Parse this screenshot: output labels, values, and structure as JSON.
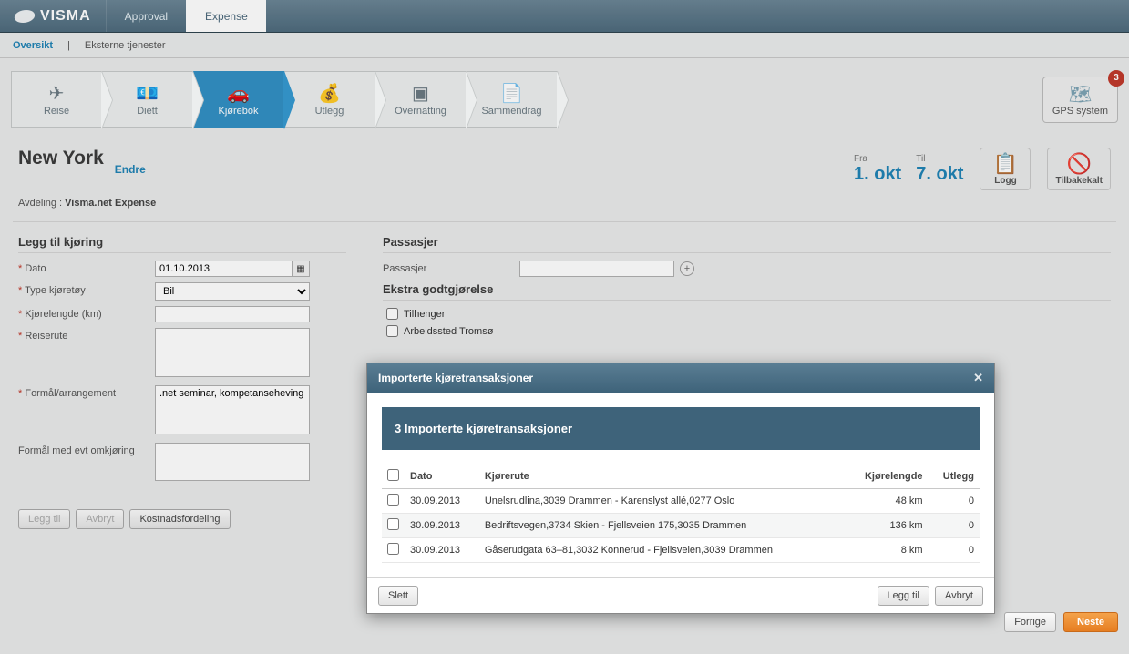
{
  "brand": "VISMA",
  "top_tabs": {
    "approval": "Approval",
    "expense": "Expense"
  },
  "subnav": {
    "overview": "Oversikt",
    "external": "Eksterne tjenester"
  },
  "steps": {
    "reise": "Reise",
    "diett": "Diett",
    "kjorebok": "Kjørebok",
    "utlegg": "Utlegg",
    "overnatting": "Overnatting",
    "sammendrag": "Sammendrag"
  },
  "gps": {
    "label": "GPS system",
    "badge": "3"
  },
  "trip": {
    "title": "New York",
    "change": "Endre",
    "dept_label": "Avdeling :",
    "dept_value": "Visma.net Expense"
  },
  "dates": {
    "from_label": "Fra",
    "to_label": "Til",
    "from": "1. okt",
    "to": "7. okt"
  },
  "actions": {
    "log": "Logg",
    "recalled": "Tilbakekalt"
  },
  "form": {
    "section_add": "Legg til kjøring",
    "date_label": "Dato",
    "date_value": "01.10.2013",
    "vehicle_label": "Type kjøretøy",
    "vehicle_value": "Bil",
    "distance_label": "Kjørelengde (km)",
    "distance_value": "",
    "route_label": "Reiserute",
    "route_value": "",
    "purpose_label": "Formål/arrangement",
    "purpose_value": ".net seminar, kompetanseheving",
    "detour_label": "Formål med evt omkjøring",
    "detour_value": "",
    "passenger_section": "Passasjer",
    "passenger_label": "Passasjer",
    "extra_section": "Ekstra godtgjørelse",
    "trailer": "Tilhenger",
    "workplace": "Arbeidssted Tromsø",
    "add_btn": "Legg til",
    "cancel_btn": "Avbryt",
    "cost_btn": "Kostnadsfordeling"
  },
  "modal": {
    "title": "Importerte kjøretransaksjoner",
    "banner": "3 Importerte kjøretransaksjoner",
    "cols": {
      "date": "Dato",
      "route": "Kjørerute",
      "dist": "Kjørelengde",
      "exp": "Utlegg"
    },
    "rows": [
      {
        "date": "30.09.2013",
        "route": "Unelsrudlina,3039 Drammen - Karenslyst allé,0277 Oslo",
        "dist": "48 km",
        "exp": "0"
      },
      {
        "date": "30.09.2013",
        "route": "Bedriftsvegen,3734 Skien - Fjellsveien 175,3035 Drammen",
        "dist": "136 km",
        "exp": "0"
      },
      {
        "date": "30.09.2013",
        "route": "Gåserudgata 63–81,3032 Konnerud - Fjellsveien,3039 Drammen",
        "dist": "8 km",
        "exp": "0"
      }
    ],
    "delete": "Slett",
    "add": "Legg til",
    "cancel": "Avbryt"
  },
  "footer": {
    "prev": "Forrige",
    "next": "Neste"
  }
}
